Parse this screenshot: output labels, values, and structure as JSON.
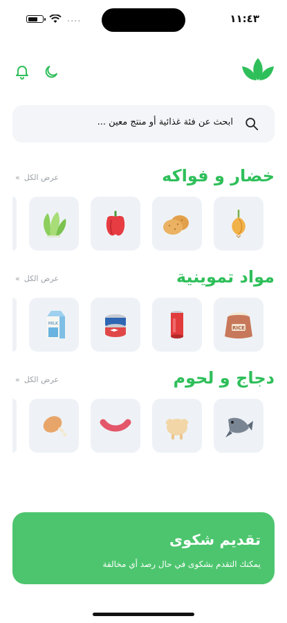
{
  "status_bar": {
    "time": "١١:٤٣",
    "dots": "...."
  },
  "topbar": {
    "logo": "leaf-logo",
    "icons": [
      "moon-icon",
      "bell-icon"
    ]
  },
  "search": {
    "placeholder": "ابحث عن فئة غذائية أو منتج معين ..."
  },
  "sections": [
    {
      "title": "خضار و فواكه",
      "view_all": "عرض الكل",
      "items": [
        "onion-icon",
        "potato-icon",
        "bell-pepper-icon",
        "lettuce-icon"
      ]
    },
    {
      "title": "مواد تموينية",
      "view_all": "عرض الكل",
      "items": [
        "rice-sack-icon",
        "soda-can-icon",
        "canned-fish-icon",
        "milk-carton-icon"
      ]
    },
    {
      "title": "دجاج و لحوم",
      "view_all": "عرض الكل",
      "items": [
        "fish-icon",
        "chicken-icon",
        "sausage-icon",
        "drumstick-icon"
      ]
    }
  ],
  "complaint": {
    "title": "تقديم شكوى",
    "subtitle": "يمكنك التقدم بشكوى في حال رصد أي مخالفة"
  },
  "colors": {
    "accent": "#2fbf5a",
    "banner": "#4dc56e",
    "card": "#eef2f6"
  }
}
